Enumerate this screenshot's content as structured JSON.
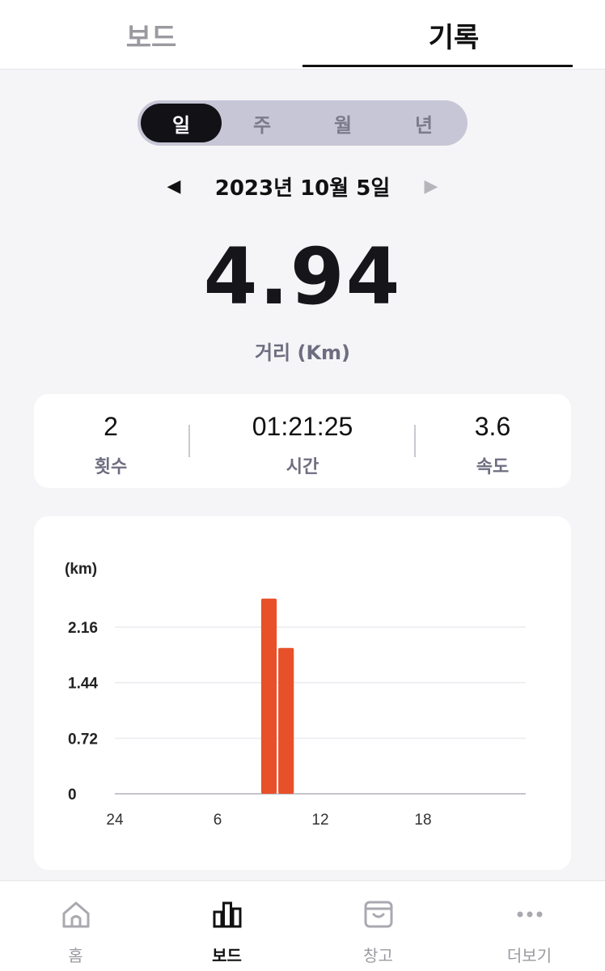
{
  "top_tabs": [
    {
      "label": "보드",
      "active": false
    },
    {
      "label": "기록",
      "active": true
    }
  ],
  "period_selector": {
    "items": [
      {
        "label": "일",
        "active": true
      },
      {
        "label": "주",
        "active": false
      },
      {
        "label": "월",
        "active": false
      },
      {
        "label": "년",
        "active": false
      }
    ]
  },
  "date_nav": {
    "date": "2023년 10월 5일",
    "prev_icon": "triangle-left-icon",
    "next_icon": "triangle-right-icon"
  },
  "summary": {
    "value": "4.94",
    "label": "거리 (Km)"
  },
  "stats": [
    {
      "value": "2",
      "label": "횟수"
    },
    {
      "value": "01:21:25",
      "label": "시간"
    },
    {
      "value": "3.6",
      "label": "속도"
    }
  ],
  "chart_data": {
    "type": "bar",
    "unit_label": "(km)",
    "x": [
      9,
      10
    ],
    "values": [
      2.53,
      1.89
    ],
    "xlim": [
      0,
      24
    ],
    "ylim": [
      0,
      2.16
    ],
    "y_ticks": [
      {
        "value": 0,
        "label": "0"
      },
      {
        "value": 0.72,
        "label": "0.72"
      },
      {
        "value": 1.44,
        "label": "1.44"
      },
      {
        "value": 2.16,
        "label": "2.16"
      }
    ],
    "x_ticks": [
      {
        "value": 0,
        "label": "24"
      },
      {
        "value": 6,
        "label": "6"
      },
      {
        "value": 12,
        "label": "12"
      },
      {
        "value": 18,
        "label": "18"
      }
    ],
    "bar_color": "#e8502a",
    "grid": true
  },
  "bottom_nav": [
    {
      "label": "홈",
      "icon": "home-icon",
      "active": false
    },
    {
      "label": "보드",
      "icon": "bar-chart-icon",
      "active": true
    },
    {
      "label": "창고",
      "icon": "storage-box-icon",
      "active": false
    },
    {
      "label": "더보기",
      "icon": "more-dots-icon",
      "active": false
    }
  ]
}
